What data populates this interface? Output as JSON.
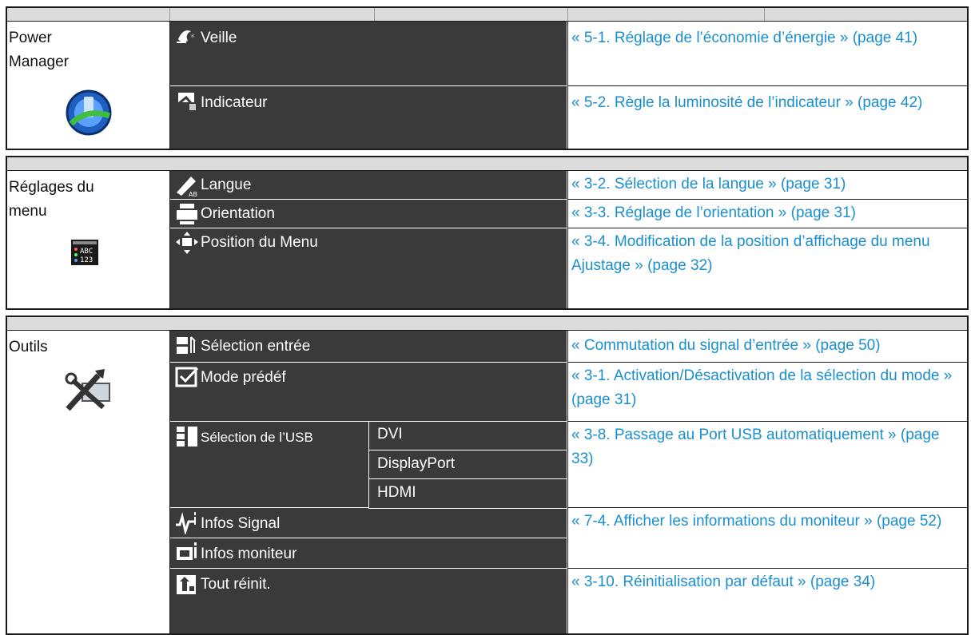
{
  "sections": [
    {
      "category": "Power\nManager",
      "category_icon": "power-manager-icon",
      "items": [
        {
          "icon": "sleep-icon",
          "label": "Veille",
          "ref": "« 5-1. Réglage de l’économie d’énergie » (page 41)"
        },
        {
          "icon": "indicator-icon",
          "label": "Indicateur",
          "ref": "« 5-2. Règle la luminosité de l’indicateur » (page 42)"
        }
      ]
    },
    {
      "category": "Réglages du\nmenu",
      "category_icon": "menu-settings-icon",
      "items": [
        {
          "icon": "language-icon",
          "label": "Langue",
          "ref": "« 3-2. Sélection de la langue » (page 31)"
        },
        {
          "icon": "orientation-icon",
          "label": "Orientation",
          "ref": "« 3-3. Réglage de l’orientation » (page 31)"
        },
        {
          "icon": "menu-position-icon",
          "label": "Position du Menu",
          "ref": "« 3-4. Modification de la position d’affichage du menu Ajustage » (page 32)"
        }
      ]
    },
    {
      "category": "Outils",
      "category_icon": "tools-icon",
      "items": [
        {
          "icon": "input-selection-icon",
          "label": "Sélection entrée",
          "ref": "« Commutation du signal d’entrée » (page 50)"
        },
        {
          "icon": "preset-mode-icon",
          "label": "Mode prédéf",
          "ref": "« 3-1. Activation/Désactivation de la sélection du mode » (page 31)"
        },
        {
          "icon": "usb-selection-icon",
          "label": "Sélection de l’USB",
          "sub": [
            "DVI",
            "DisplayPort",
            "HDMI"
          ],
          "ref": "« 3-8. Passage au Port USB automatiquement » (page 33)"
        },
        {
          "icon": "signal-info-icon",
          "label": "Infos Signal"
        },
        {
          "icon": "monitor-info-icon",
          "label": "Infos moniteur"
        },
        {
          "icon": "reset-icon",
          "label": "Tout réinit.",
          "ref": "« 3-10. Réinitialisation par défaut » (page 34)"
        }
      ],
      "shared_ref": "« 7-4. Afficher les informations du moniteur » (page 52)"
    }
  ]
}
